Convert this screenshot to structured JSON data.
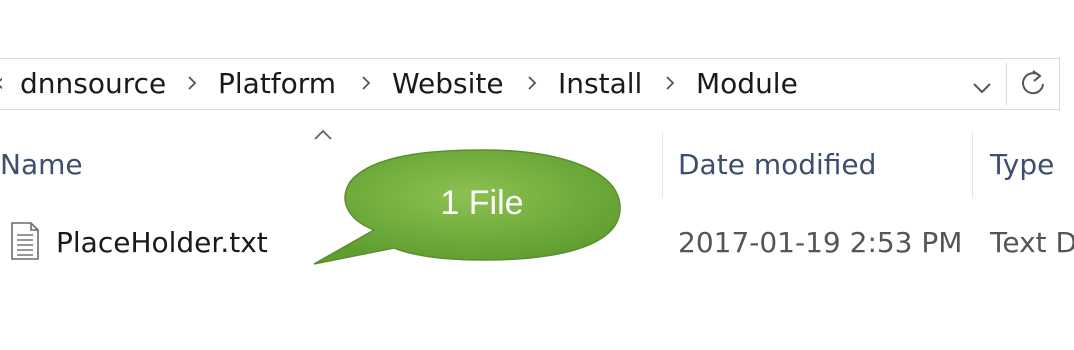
{
  "breadcrumb": {
    "items": [
      "dnnsource",
      "Platform",
      "Website",
      "Install",
      "Module"
    ]
  },
  "columns": {
    "name": "Name",
    "date_modified": "Date modified",
    "type": "Type"
  },
  "files": [
    {
      "name": "PlaceHolder.txt",
      "date_modified": "2017-01-19 2:53 PM",
      "type": "Text D",
      "icon": "text-file-icon"
    }
  ],
  "callout": {
    "text": "1 File",
    "color": "#6aab38"
  },
  "icons": {
    "dropdown": "chevron-down-icon",
    "refresh": "refresh-icon",
    "sort": "sort-ascending-icon",
    "separator": "chevron-right-icon"
  }
}
